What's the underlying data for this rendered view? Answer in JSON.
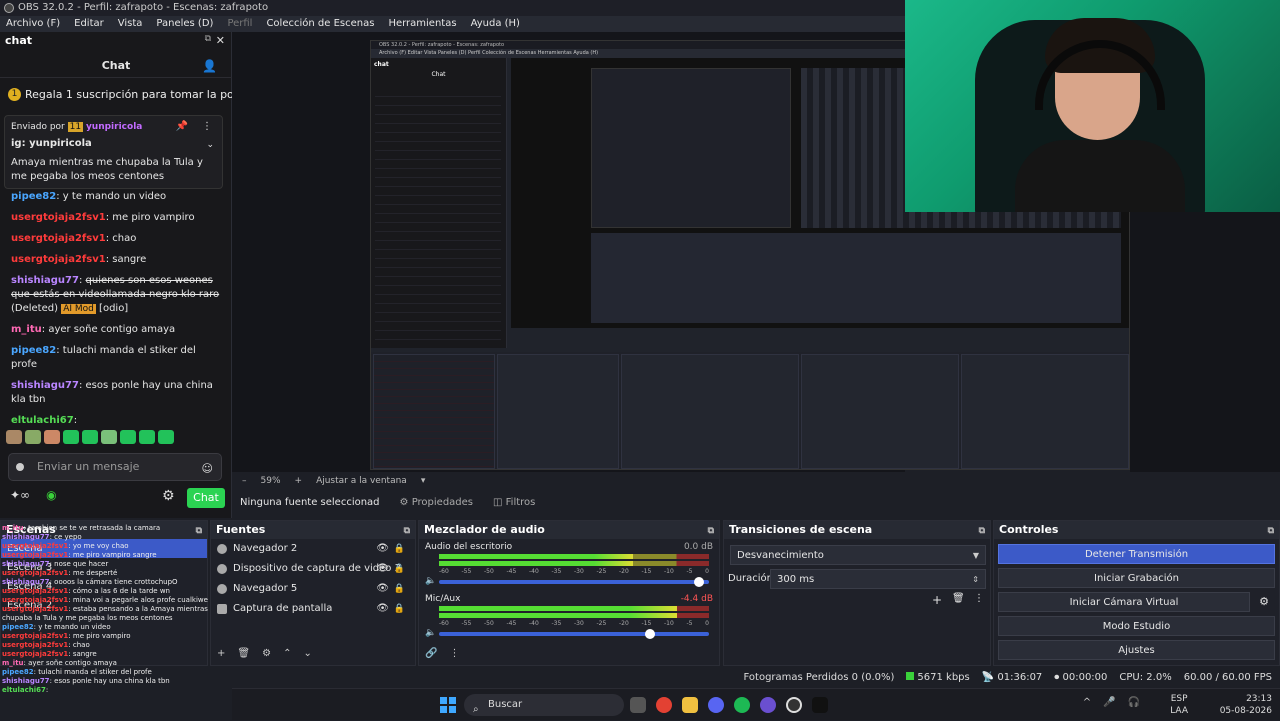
{
  "window": {
    "title": "OBS 32.0.2 - Perfil: zafrapoto - Escenas: zafrapoto"
  },
  "menu": [
    "Archivo (F)",
    "Editar",
    "Vista",
    "Paneles (D)",
    "Perfil",
    "Colección de Escenas",
    "Herramientas",
    "Ayuda (H)"
  ],
  "chat": {
    "dock_title": "chat",
    "header": "Chat",
    "gift_banner": "Regala 1 suscripción para tomar la posi",
    "pinned": {
      "sent_by_label": "Enviado por",
      "badge": "11",
      "user": "yunpiricola",
      "message": "ig: yunpiricola"
    },
    "partial_message": "Amaya mientras me chupaba la Tula y me pegaba los meos centones",
    "messages": [
      {
        "user": "pipee82",
        "text": "y te mando un video",
        "color": "u1"
      },
      {
        "user": "usergtojaja2fsv1",
        "text": "me piro vampiro",
        "color": "u2"
      },
      {
        "user": "usergtojaja2fsv1",
        "text": "chao",
        "color": "u2"
      },
      {
        "user": "usergtojaja2fsv1",
        "text": "sangre",
        "color": "u2"
      },
      {
        "user": "shishiagu77",
        "text": "quienes son esos weones que estás en videollamada negro klo raro",
        "deleted": "(Deleted)",
        "mod": "AI Mod",
        "extra": "[odio]",
        "color": "u3"
      },
      {
        "user": "m_itu",
        "text": "ayer soñe contigo amaya",
        "color": "u4"
      },
      {
        "user": "pipee82",
        "text": "tulachi manda el stiker del profe",
        "color": "u1"
      },
      {
        "user": "shishiagu77",
        "text": "esos ponle hay una china kla tbn",
        "color": "u3"
      },
      {
        "user": "eltulachi67",
        "text": "",
        "color": "u5"
      }
    ],
    "input_placeholder": "Enviar un mensaje",
    "send_label": "Chat"
  },
  "preview": {
    "zoom": "59%",
    "fit_label": "Ajustar a la ventana",
    "source_label": "Ninguna fuente seleccionad",
    "properties_label": "Propiedades",
    "filters_label": "Filtros"
  },
  "scenes": {
    "title": "Escenas",
    "items": [
      "Escena",
      "Escena 3",
      "Escena 4",
      "Escena 2"
    ],
    "selected": 0
  },
  "overlay_chat": [
    {
      "user": "m_itu",
      "text": "tambien se te ve retrasada la camara"
    },
    {
      "user": "shishiagu77",
      "text": "ce yepo"
    },
    {
      "user": "usergtojaja2fsv1",
      "text": "yo me voy chao"
    },
    {
      "user": "usergtojaja2fsv1",
      "text": "me piro vampiro sangre"
    },
    {
      "user": "shishiagu77",
      "text": "nose que hacer"
    },
    {
      "user": "usergtojaja2fsv1",
      "text": "me desperté"
    },
    {
      "user": "shishiagu77",
      "text": "oooos la cámara tiene crottochupO"
    },
    {
      "user": "usergtojaja2fsv1",
      "text": "cómo a las 6 de la tarde wn"
    },
    {
      "user": "usergtojaja2fsv1",
      "text": "mina voi a pegarle alos profe cualkiwe wee yunpiricola me manda yerbas"
    },
    {
      "user": "usergtojaja2fsv1",
      "text": "estaba pensando a la Amaya mientras me chupaba la Tula y me pegaba los meos centones"
    },
    {
      "user": "pipee82",
      "text": "y te mando un video"
    },
    {
      "user": "usergtojaja2fsv1",
      "text": "me piro vampiro"
    },
    {
      "user": "usergtojaja2fsv1",
      "text": "chao"
    },
    {
      "user": "usergtojaja2fsv1",
      "text": "sangre"
    },
    {
      "user": "m_itu",
      "text": "ayer soñe contigo amaya"
    },
    {
      "user": "pipee82",
      "text": "tulachi manda el stiker del profe"
    },
    {
      "user": "shishiagu77",
      "text": "esos ponle hay una china kla tbn"
    },
    {
      "user": "eltulachi67",
      "text": ""
    }
  ],
  "sources": {
    "title": "Fuentes",
    "items": [
      "Navegador 2",
      "Dispositivo de captura de video 3",
      "Navegador 5",
      "Captura de pantalla"
    ]
  },
  "mixer": {
    "title": "Mezclador de audio",
    "tracks": [
      {
        "name": "Audio del escritorio",
        "db": "0.0 dB",
        "level": 0.72,
        "volume": 0.98
      },
      {
        "name": "Mic/Aux",
        "db": "-4.4 dB",
        "level": 0.88,
        "volume": 0.8
      }
    ],
    "scale": [
      "-60",
      "-55",
      "-50",
      "-45",
      "-40",
      "-35",
      "-30",
      "-25",
      "-20",
      "-15",
      "-10",
      "-5",
      "0"
    ]
  },
  "transitions": {
    "title": "Transiciones de escena",
    "selected": "Desvanecimiento",
    "duration_label": "Duración",
    "duration_value": "300 ms"
  },
  "controls": {
    "title": "Controles",
    "buttons": [
      "Detener Transmisión",
      "Iniciar Grabación",
      "Iniciar Cámara Virtual",
      "Modo Estudio",
      "Ajustes"
    ]
  },
  "status": {
    "dropped": "Fotogramas Perdidos 0 (0.0%)",
    "bitrate": "5671 kbps",
    "stream_time": "01:36:07",
    "rec_time": "00:00:00",
    "cpu": "CPU: 2.0%",
    "fps": "60.00 / 60.00 FPS"
  },
  "taskbar": {
    "search": "Buscar",
    "lang1": "ESP",
    "lang2": "LAA",
    "time": "23:13",
    "date": "05-08-2026"
  },
  "colors": {
    "accent": "#3c5ac8",
    "chat_send": "#2bd352",
    "webcam_bg": "#1bb889"
  }
}
